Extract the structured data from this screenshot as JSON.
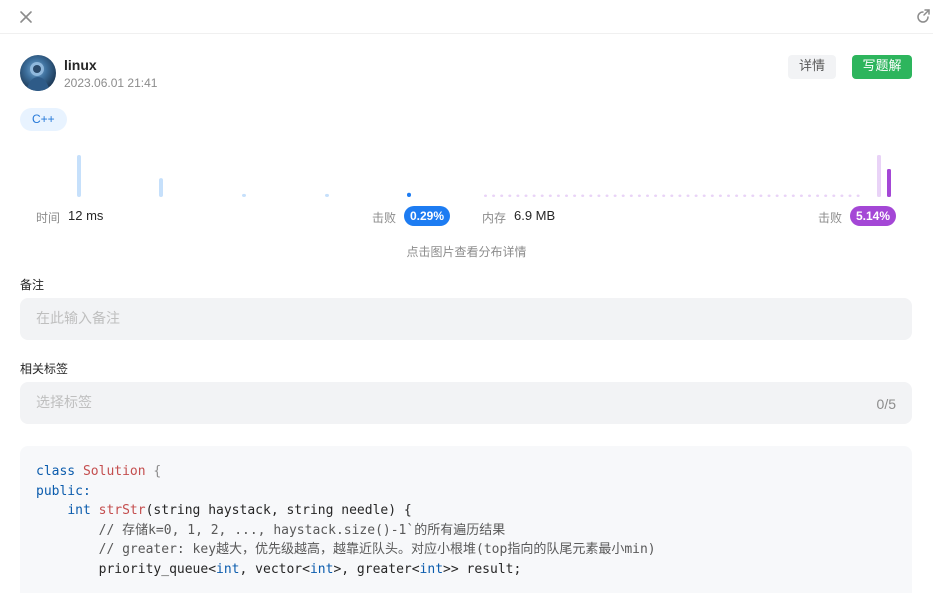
{
  "window": {
    "close_icon": "close-icon",
    "share_icon": "share-icon"
  },
  "author": {
    "name": "linux",
    "timestamp": "2023.06.01 21:41"
  },
  "actions": {
    "detail_label": "详情",
    "solution_label": "写题解",
    "solution_color": "#2db55d"
  },
  "language_tag": "C++",
  "runtime": {
    "label": "时间",
    "value": "12 ms",
    "beat_label": "击败",
    "beat_value": "0.29%",
    "badge_color": "#1d7cf2"
  },
  "memory": {
    "label": "内存",
    "value": "6.9 MB",
    "beat_label": "击败",
    "beat_value": "5.14%",
    "badge_color": "#a447d6"
  },
  "chart_hint": "点击图片查看分布详情",
  "notes": {
    "label": "备注",
    "placeholder": "在此输入备注"
  },
  "tags": {
    "label": "相关标签",
    "placeholder": "选择标签",
    "count": "0/5"
  },
  "code": {
    "line1_kw": "class",
    "line1_name": "Solution",
    "line1_brace": "{",
    "line2": "public:",
    "line3_type": "int",
    "line3_fn": "strStr",
    "line3_params": "(string haystack, string needle) {",
    "line4": "// 存储k=0, 1, 2, ..., haystack.size()-1`的所有遍历结果",
    "line5": "// greater: key越大，优先级越高，越靠近队头。对应小根堆(top指向的队尾元素最小min)",
    "line6_a": "priority_queue<",
    "line6_b": "int",
    "line6_c": ", vector<",
    "line6_d": "int",
    "line6_e": ">, greater<",
    "line6_f": "int",
    "line6_g": ">> result;"
  },
  "chart_data": [
    {
      "type": "bar",
      "series": [
        {
          "name": "",
          "values": [
            40,
            18,
            3,
            3,
            4
          ]
        }
      ],
      "highlight_index": 4,
      "color": "#c6e0fb",
      "highlight_color": "#1d7cf2"
    },
    {
      "type": "bar",
      "series": [
        {
          "name": "",
          "values": [
            1,
            1,
            1,
            1,
            1,
            1,
            1,
            1,
            1,
            1,
            1,
            1,
            1,
            1,
            1,
            1,
            1,
            1,
            1,
            1,
            1,
            1,
            1,
            1,
            1,
            1,
            1,
            1,
            1,
            1,
            1,
            1,
            1,
            1,
            1,
            1,
            1,
            1,
            1,
            1,
            1,
            1,
            1,
            1,
            1,
            1,
            1,
            42,
            28
          ]
        }
      ],
      "highlight_index": 48,
      "color": "#e9d3f7",
      "highlight_color": "#a447d6"
    }
  ]
}
